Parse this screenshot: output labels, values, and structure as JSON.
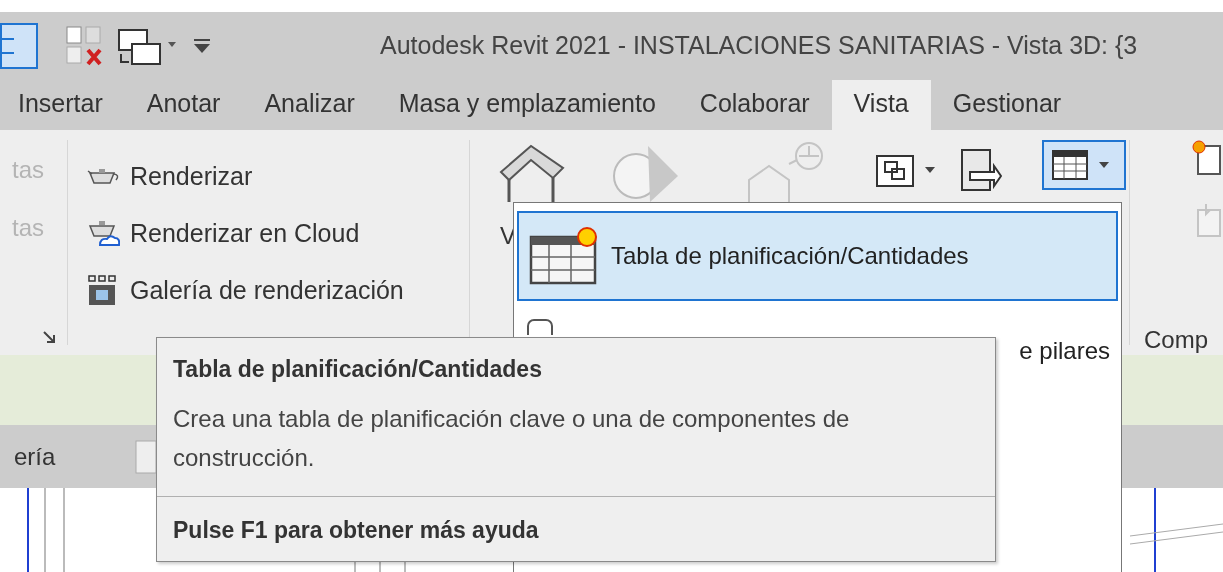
{
  "title_bar": {
    "title": "Autodesk Revit 2021 - INSTALACIONES SANITARIAS - Vista 3D: {3"
  },
  "tabs": [
    {
      "label": "Insertar",
      "selected": false
    },
    {
      "label": "Anotar",
      "selected": false
    },
    {
      "label": "Analizar",
      "selected": false
    },
    {
      "label": "Masa y emplazamiento",
      "selected": false
    },
    {
      "label": "Colaborar",
      "selected": false
    },
    {
      "label": "Vista",
      "selected": true
    },
    {
      "label": "Gestionar",
      "selected": false
    }
  ],
  "ribbon": {
    "left_panel": {
      "items": [
        {
          "label": "tas",
          "disabled": true
        },
        {
          "label": "tas",
          "disabled": true
        }
      ]
    },
    "render_panel": {
      "items": [
        {
          "label": "Renderizar"
        },
        {
          "label": "Renderizar  en Cloud"
        },
        {
          "label": "Galería de  renderización"
        }
      ]
    },
    "view_panel": {
      "label_fragment": "V",
      "schedules_button": {
        "active": true
      }
    },
    "right_panel": {
      "label": "Comp"
    }
  },
  "dropdown_menu": {
    "items": [
      {
        "label": "Tabla de planificación/Cantidades",
        "selected": true
      },
      {
        "label": "e pilares",
        "selected": false
      }
    ]
  },
  "tooltip": {
    "title": "Tabla de planificación/Cantidades",
    "description": "Crea una tabla de planificación clave o una de componentes de construcción.",
    "help": "Pulse F1 para obtener más ayuda"
  },
  "project_browser": {
    "title": "ería"
  }
}
